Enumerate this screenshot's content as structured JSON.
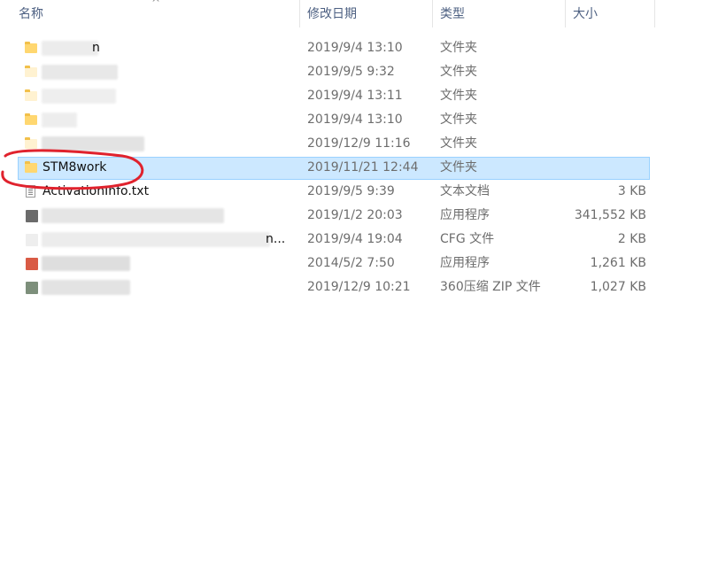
{
  "header": {
    "name_label": "名称",
    "date_label": "修改日期",
    "type_label": "类型",
    "size_label": "大小",
    "sort_indicator": "^"
  },
  "icons": {
    "folder": "folder-icon",
    "text_file": "text-file-icon",
    "application": "application-icon",
    "config_file": "cfg-file-icon",
    "archive": "zip-archive-icon"
  },
  "colors": {
    "selection_bg": "#cce8ff",
    "selection_border": "#99d1ff",
    "annotation_red": "#e0222d",
    "header_text": "#4d6082"
  },
  "rows": [
    {
      "name": "n",
      "date": "2019/9/4 13:10",
      "type": "文件夹",
      "size": ""
    },
    {
      "name": "",
      "date": "2019/9/5 9:32",
      "type": "文件夹",
      "size": ""
    },
    {
      "name": "",
      "date": "2019/9/4 13:11",
      "type": "文件夹",
      "size": ""
    },
    {
      "name": "",
      "date": "2019/9/4 13:10",
      "type": "文件夹",
      "size": ""
    },
    {
      "name": "",
      "date": "2019/12/9 11:16",
      "type": "文件夹",
      "size": ""
    },
    {
      "name": "STM8work",
      "date": "2019/11/21 12:44",
      "type": "文件夹",
      "size": ""
    },
    {
      "name": "ActivationInfo.txt",
      "date": "2019/9/5 9:39",
      "type": "文本文档",
      "size": "3 KB"
    },
    {
      "name": "",
      "date": "2019/1/2 20:03",
      "type": "应用程序",
      "size": "341,552 KB"
    },
    {
      "name": "n...",
      "date": "2019/9/4 19:04",
      "type": "CFG 文件",
      "size": "2 KB"
    },
    {
      "name": "",
      "date": "2014/5/2 7:50",
      "type": "应用程序",
      "size": "1,261 KB"
    },
    {
      "name": "",
      "date": "2019/12/9 10:21",
      "type": "360压缩 ZIP 文件",
      "size": "1,027 KB"
    }
  ]
}
